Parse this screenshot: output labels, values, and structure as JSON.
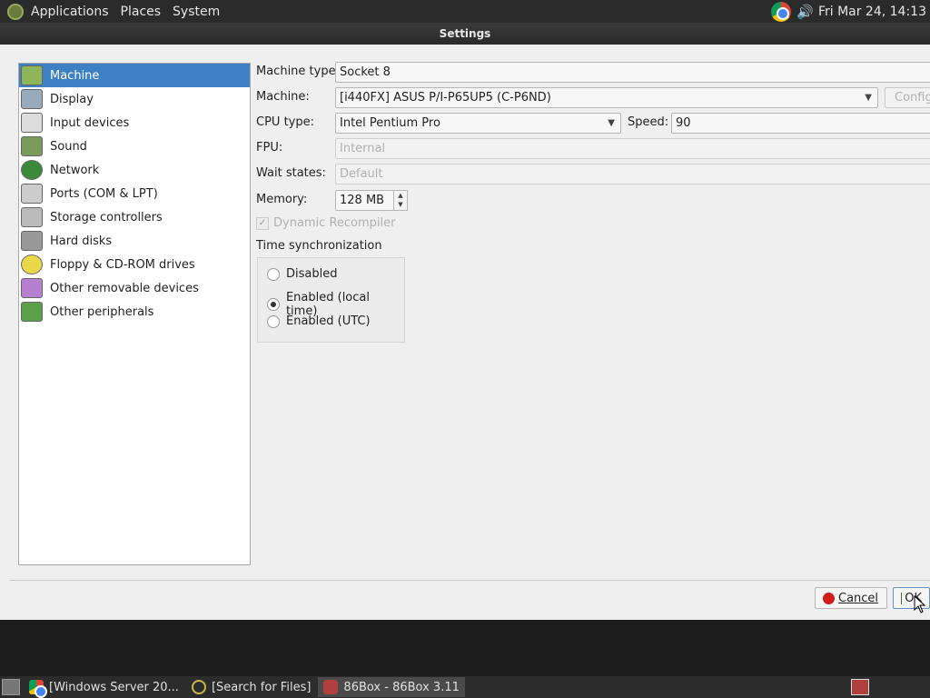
{
  "topbar": {
    "menus": [
      "Applications",
      "Places",
      "System"
    ],
    "clock": "Fri Mar 24, 14:13"
  },
  "window": {
    "title": "Settings"
  },
  "sidebar": {
    "items": [
      {
        "label": "Machine",
        "icon": "motherboard-icon",
        "selected": true
      },
      {
        "label": "Display",
        "icon": "display-icon"
      },
      {
        "label": "Input devices",
        "icon": "keyboard-icon"
      },
      {
        "label": "Sound",
        "icon": "sound-card-icon"
      },
      {
        "label": "Network",
        "icon": "network-icon"
      },
      {
        "label": "Ports (COM & LPT)",
        "icon": "ports-icon"
      },
      {
        "label": "Storage controllers",
        "icon": "storage-icon"
      },
      {
        "label": "Hard disks",
        "icon": "hard-disk-icon"
      },
      {
        "label": "Floppy & CD-ROM drives",
        "icon": "floppy-cdrom-icon"
      },
      {
        "label": "Other removable devices",
        "icon": "removable-device-icon"
      },
      {
        "label": "Other peripherals",
        "icon": "peripherals-icon"
      }
    ]
  },
  "form": {
    "machine_type_label": "Machine type:",
    "machine_type_value": "Socket 8",
    "machine_label": "Machine:",
    "machine_value": "[i440FX] ASUS P/I-P65UP5 (C-P6ND)",
    "configure_label": "Config",
    "cpu_type_label": "CPU type:",
    "cpu_type_value": "Intel Pentium Pro",
    "speed_label": "Speed:",
    "speed_value": "90",
    "fpu_label": "FPU:",
    "fpu_value": "Internal",
    "wait_states_label": "Wait states:",
    "wait_states_value": "Default",
    "memory_label": "Memory:",
    "memory_value": "128 MB",
    "dynamic_recompiler_label": "Dynamic Recompiler",
    "time_sync_title": "Time synchronization",
    "time_sync_options": [
      "Disabled",
      "Enabled (local time)",
      "Enabled (UTC)"
    ],
    "time_sync_selected": "Enabled (local time)"
  },
  "buttons": {
    "cancel_label": "Cancel",
    "ok_label": "OK"
  },
  "taskbar": {
    "tasks": [
      "[Windows Server 20...",
      "[Search for Files]",
      "86Box - 86Box 3.11"
    ]
  },
  "colors": {
    "selection": "#3d80c4",
    "panel": "#2b2b2b"
  }
}
